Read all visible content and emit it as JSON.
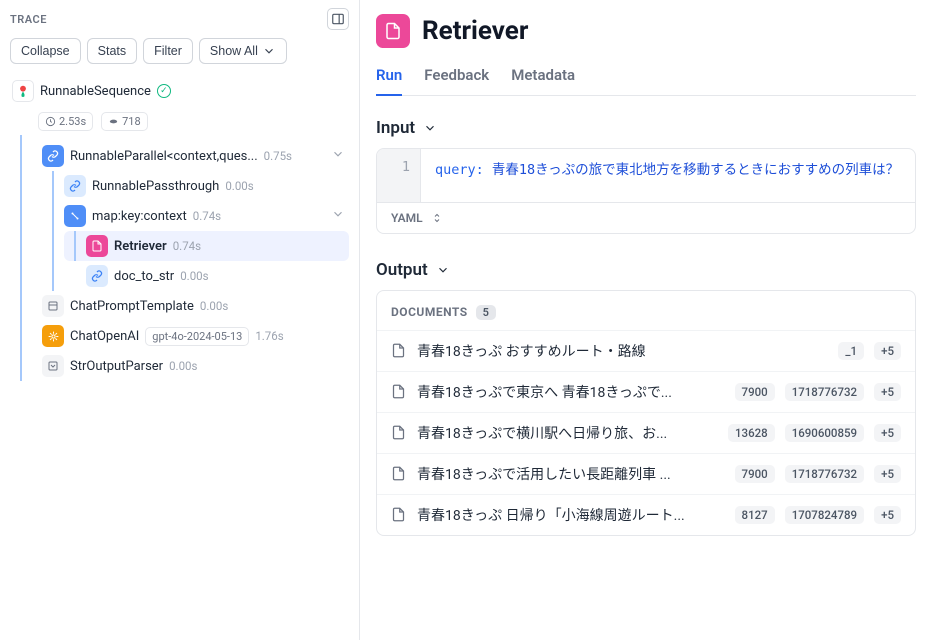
{
  "trace": {
    "title": "TRACE",
    "buttons": {
      "collapse": "Collapse",
      "stats": "Stats",
      "filter": "Filter",
      "show_all": "Show All"
    },
    "root": {
      "label": "RunnableSequence",
      "duration": "2.53s",
      "tokens": "718"
    },
    "nodes": {
      "parallel": {
        "label": "RunnableParallel<context,ques...",
        "time": "0.75s"
      },
      "passthrough": {
        "label": "RunnablePassthrough",
        "time": "0.00s"
      },
      "mapkey": {
        "label": "map:key:context",
        "time": "0.74s"
      },
      "retriever": {
        "label": "Retriever",
        "time": "0.74s"
      },
      "doc_to_str": {
        "label": "doc_to_str",
        "time": "0.00s"
      },
      "prompt": {
        "label": "ChatPromptTemplate",
        "time": "0.00s"
      },
      "openai": {
        "label": "ChatOpenAI",
        "model": "gpt-4o-2024-05-13",
        "time": "1.76s"
      },
      "strout": {
        "label": "StrOutputParser",
        "time": "0.00s"
      }
    }
  },
  "page": {
    "title": "Retriever",
    "tabs": {
      "run": "Run",
      "feedback": "Feedback",
      "metadata": "Metadata"
    }
  },
  "input": {
    "section": "Input",
    "line": "1",
    "key": "query:",
    "value": "青春18きっぷの旅で東北地方を移動するときにおすすめの列車は？",
    "format": "YAML"
  },
  "output": {
    "section": "Output",
    "head": "DOCUMENTS",
    "count": "5",
    "docs": [
      {
        "title": "青春18きっぷ おすすめルート・路線",
        "tags": [
          "_1",
          "+5"
        ]
      },
      {
        "title": "青春18きっぷで東京へ 青春18きっぷで...",
        "tags": [
          "7900",
          "1718776732",
          "+5"
        ]
      },
      {
        "title": "青春18きっぷで横川駅へ日帰り旅、お...",
        "tags": [
          "13628",
          "1690600859",
          "+5"
        ]
      },
      {
        "title": "青春18きっぷで活用したい長距離列車 ...",
        "tags": [
          "7900",
          "1718776732",
          "+5"
        ]
      },
      {
        "title": "青春18きっぷ 日帰り「小海線周遊ルート...",
        "tags": [
          "8127",
          "1707824789",
          "+5"
        ]
      }
    ]
  }
}
